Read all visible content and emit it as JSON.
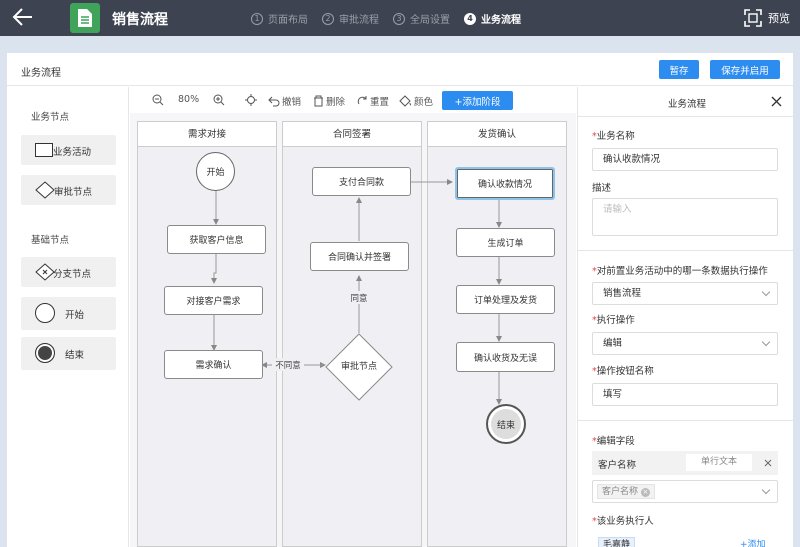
{
  "header": {
    "app_title": "销售流程",
    "steps": [
      {
        "num": "1",
        "label": "页面布局"
      },
      {
        "num": "2",
        "label": "审批流程"
      },
      {
        "num": "3",
        "label": "全局设置"
      },
      {
        "num": "4",
        "label": "业务流程"
      }
    ],
    "preview_label": "预览"
  },
  "card": {
    "title": "业务流程",
    "save_draft": "暂存",
    "save_enable": "保存并启用"
  },
  "palette": {
    "section_business": "业务节点",
    "business_items": [
      "业务活动",
      "审批节点"
    ],
    "section_basic": "基础节点",
    "basic_items": [
      "分支节点",
      "开始",
      "结束"
    ]
  },
  "toolbar": {
    "zoom": "80%",
    "undo": "撤销",
    "delete": "删除",
    "reset": "重置",
    "color": "颜色",
    "add_stage": "+添加阶段"
  },
  "lanes": [
    "需求对接",
    "合同签署",
    "发货确认"
  ],
  "nodes": {
    "start": "开始",
    "get_info": "获取客户信息",
    "connect_needs": "对接客户需求",
    "confirm_needs": "需求确认",
    "approval": "审批节点",
    "contract_sign": "合同确认并签署",
    "pay_contract": "支付合同款",
    "confirm_payment": "确认收款情况",
    "gen_order": "生成订单",
    "process_order": "订单处理及发货",
    "confirm_receipt": "确认收货及无误",
    "end": "结束"
  },
  "edges": {
    "agree": "同意",
    "disagree": "不同意"
  },
  "panel": {
    "title": "业务流程",
    "name_label": "业务名称",
    "name_value": "确认收款情况",
    "desc_label": "描述",
    "desc_placeholder": "请输入",
    "pre_label": "对前置业务活动中的哪一条数据执行操作",
    "pre_value": "销售流程",
    "op_label": "执行操作",
    "op_value": "编辑",
    "btn_name_label": "操作按钮名称",
    "btn_name_value": "填写",
    "fields_label": "编辑字段",
    "field_name": "客户名称",
    "field_type": "单行文本",
    "field_tag": "客户名称",
    "executor_label": "该业务执行人",
    "executor_tag": "毛嘉静",
    "add_label": "+添加"
  }
}
